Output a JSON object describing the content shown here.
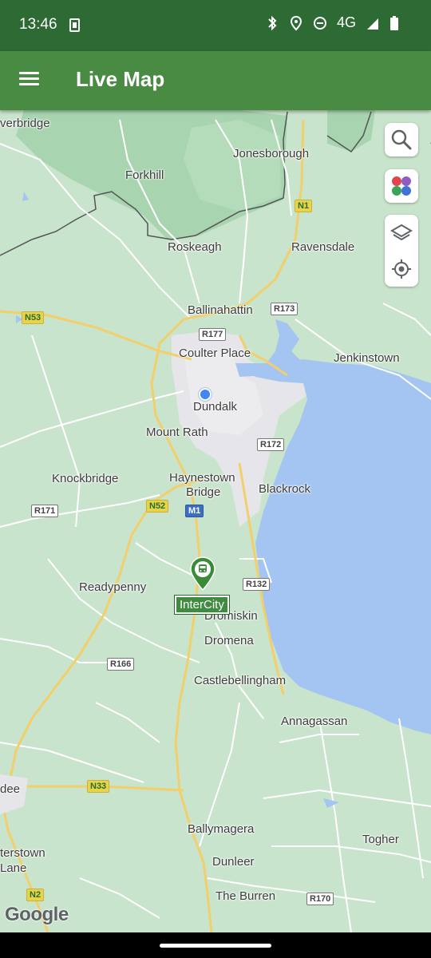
{
  "status_bar": {
    "time": "13:46",
    "network": "4G",
    "icons": [
      "sim-card-icon",
      "bluetooth-icon",
      "location-icon",
      "do-not-disturb-icon",
      "signal-icon",
      "battery-icon"
    ]
  },
  "app_bar": {
    "title": "Live Map",
    "menu_icon": "hamburger-menu-icon"
  },
  "map_controls": {
    "search_icon": "search-icon",
    "colors_icon": "color-palette-icon",
    "layers_icon": "layers-icon",
    "locate_icon": "my-location-icon"
  },
  "places": {
    "verbridge": "verbridge",
    "jonesborough": "Jonesborough",
    "forkhill": "Forkhill",
    "roskeagh": "Roskeagh",
    "ravensdale": "Ravensdale",
    "ballinahattin": "Ballinahattin",
    "coulter_place": "Coulter Place",
    "jenkinstown": "Jenkinstown",
    "dundalk": "Dundalk",
    "mount_rath": "Mount Rath",
    "knockbridge": "Knockbridge",
    "haynestown_1": "Haynestown",
    "haynestown_2": "Bridge",
    "blackrock": "Blackrock",
    "readypenny": "Readypenny",
    "dromiskin": "Dromiskin",
    "dromena": "Dromena",
    "castlebellingham": "Castlebellingham",
    "annagassan": "Annagassan",
    "dee": "dee",
    "ballymagera": "Ballymagera",
    "togher": "Togher",
    "terstown_1": "terstown",
    "terstown_2": "Lane",
    "dunleer": "Dunleer",
    "the_burren": "The Burren"
  },
  "roads": {
    "n1": "N1",
    "n53": "N53",
    "r173": "R173",
    "r177": "R177",
    "r172": "R172",
    "r171": "R171",
    "n52": "N52",
    "m1": "M1",
    "r132": "R132",
    "r166": "R166",
    "n33": "N33",
    "n2": "N2",
    "r170": "R170"
  },
  "stop_marker": {
    "label": "InterCity",
    "icon": "train-icon"
  },
  "attribution": "Google",
  "colors": {
    "status_bar": "#2e6a34",
    "app_bar": "#4a8b43",
    "water": "#a4c4f2",
    "land": "#c9e4cd",
    "urban": "#e8e8ec",
    "major_road": "#f5d36a",
    "user_location": "#4285f4"
  }
}
